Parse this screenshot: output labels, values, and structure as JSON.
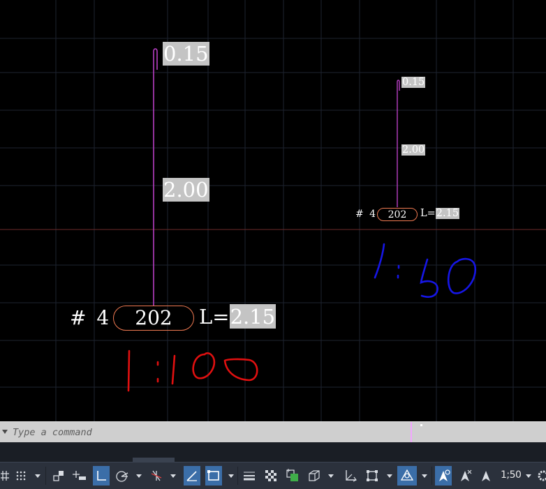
{
  "drawing": {
    "large_label": {
      "top_value": "0.15",
      "mid_value": "2.00",
      "prefix": "# 4",
      "tag": "202",
      "length_prefix": "L=",
      "length_value": "2.15"
    },
    "small_label": {
      "top_value": "0.15",
      "mid_value": "2.00",
      "prefix": "# 4",
      "tag": "202",
      "length_prefix": "L=",
      "length_value": "2.15"
    },
    "colors": {
      "background": "#000000",
      "grid": "#1e2330",
      "bar": "#b83fc4",
      "pill_border": "#f07a52",
      "annotation_red": "#e01010",
      "annotation_blue": "#1616e6"
    }
  },
  "command_line": {
    "placeholder": "Type a command"
  },
  "status_bar": {
    "scale_label": "1;50",
    "icons": [
      "grid-icon",
      "snap-icon",
      "infer-icon",
      "dynamic-input-icon",
      "ortho-icon",
      "polar-icon",
      "isodraft-icon",
      "object-snap-tracking-icon",
      "object-snap-icon",
      "lineweight-icon",
      "transparency-icon",
      "selection-cycling-icon",
      "3d-osnap-icon",
      "dynamic-ucs-icon",
      "selection-filter-icon",
      "gizmo-icon",
      "annotation-visibility-icon",
      "autoscale-icon",
      "annotation-scale-icon",
      "gear-icon"
    ]
  }
}
